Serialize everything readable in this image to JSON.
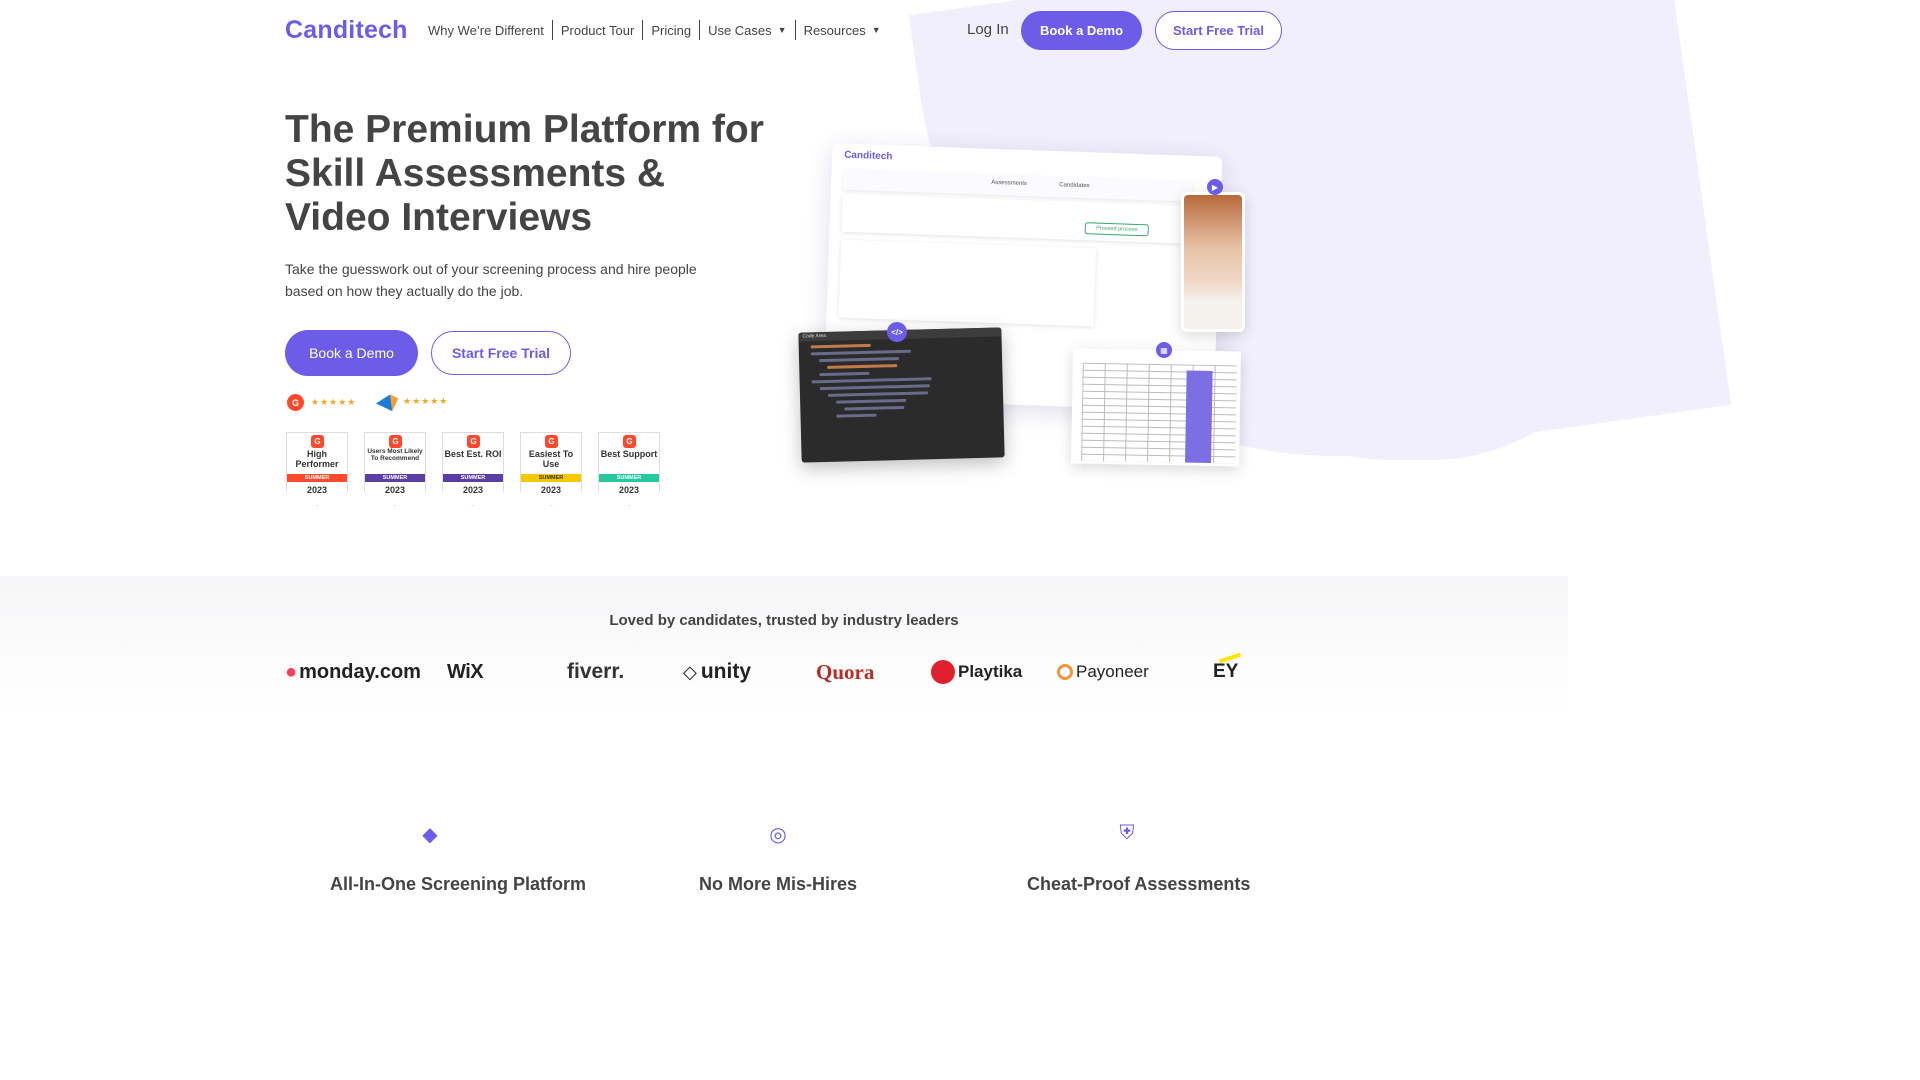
{
  "brand": {
    "name": "Canditech",
    "accent": "#6c5ce7"
  },
  "nav": {
    "items": [
      {
        "label": "Why We’re Different",
        "dropdown": false
      },
      {
        "label": "Product Tour",
        "dropdown": false
      },
      {
        "label": "Pricing",
        "dropdown": false
      },
      {
        "label": "Use Cases",
        "dropdown": true
      },
      {
        "label": "Resources",
        "dropdown": true
      }
    ],
    "login": "Log In",
    "book_demo": "Book a Demo",
    "free_trial": "Start Free Trial"
  },
  "hero": {
    "title": "The Premium Platform for Skill Assessments & Video Interviews",
    "subtitle": "Take the guesswork out of your screening process and hire people based on how they actually do the job.",
    "book_demo": "Book a Demo",
    "free_trial": "Start Free Trial",
    "ratings": [
      {
        "source_icon": "g2-icon",
        "stars": 5
      },
      {
        "source_icon": "capterra-icon",
        "stars": 5
      }
    ],
    "badges": [
      {
        "title": "High Performer",
        "season": "SUMMER",
        "year": "2023",
        "color": "#ff492c"
      },
      {
        "title": "Users Most Likely To Recommend",
        "season": "SUMMER",
        "year": "2023",
        "color": "#5b3fa6"
      },
      {
        "title": "Best Est. ROI",
        "season": "SUMMER",
        "year": "2023",
        "color": "#5b3fa6"
      },
      {
        "title": "Easiest To Use",
        "season": "SUMMER",
        "year": "2023",
        "color": "#f8c800"
      },
      {
        "title": "Best Support",
        "season": "SUMMER",
        "year": "2023",
        "color": "#27c7a0"
      }
    ],
    "mockup": {
      "logo": "Canditech",
      "tab_assessments": "Assessments",
      "tab_candidates": "Candidates",
      "proceed": "Proceed process",
      "code_header": "Code Area"
    }
  },
  "trusted": {
    "title": "Loved by candidates, trusted by industry leaders",
    "logos": [
      "monday.com",
      "WiX",
      "fiverr.",
      "unity",
      "Quora",
      "Playtika",
      "Payoneer",
      "EY"
    ]
  },
  "features": [
    {
      "icon": "diamond-icon",
      "title": "All-In-One Screening Platform"
    },
    {
      "icon": "fingerprint-icon",
      "title": "No More Mis-Hires"
    },
    {
      "icon": "shield-icon",
      "title": "Cheat-Proof Assessments"
    }
  ]
}
